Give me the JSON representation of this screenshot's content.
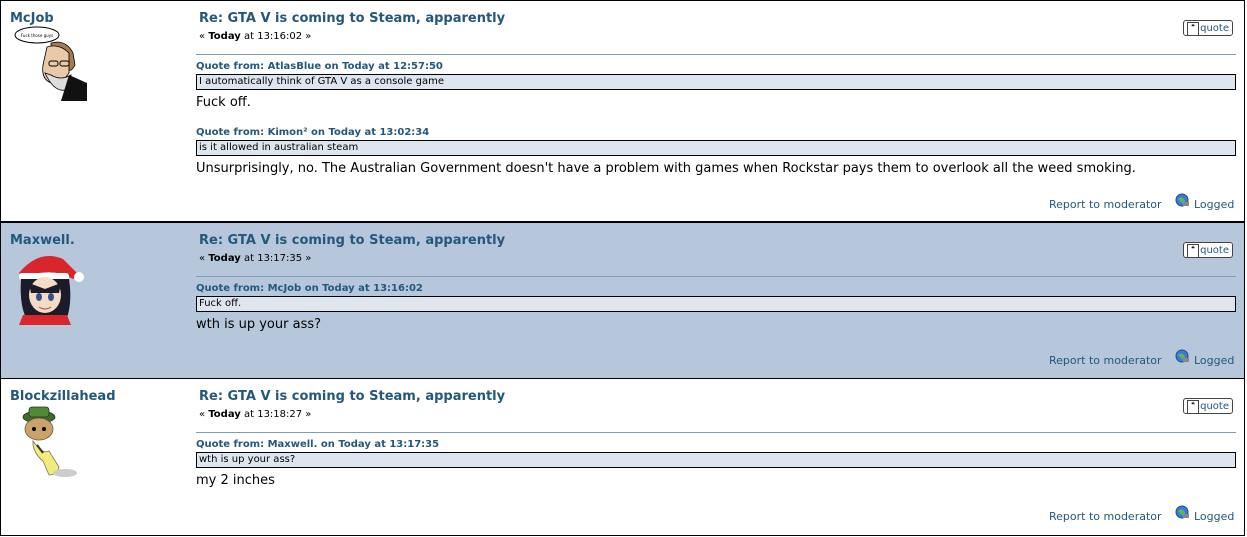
{
  "posts": [
    {
      "author": "McJob",
      "subject": "Re: GTA V is coming to Steam, apparently",
      "date_prefix": "«",
      "date_bold": "Today",
      "date_rest": " at 13:16:02 »",
      "avatar_caption": "Fuck those guys",
      "quote_label": "quote",
      "quotes": [
        {
          "header": "Quote from: AtlasBlue on Today at 12:57:50",
          "text": "I automatically think of GTA V as a console game"
        },
        {
          "header": "Quote from: Kimon² on Today at 13:02:34",
          "text": "is it allowed in australian steam"
        }
      ],
      "replies": [
        "Fuck off.",
        "Unsurprisingly, no. The Australian Government doesn't have a problem with games when Rockstar pays them to overlook all the weed smoking."
      ],
      "report": "Report to moderator",
      "logged": "Logged"
    },
    {
      "author": "Maxwell.",
      "subject": "Re: GTA V is coming to Steam, apparently",
      "date_prefix": "«",
      "date_bold": "Today",
      "date_rest": " at 13:17:35 »",
      "quote_label": "quote",
      "quotes": [
        {
          "header": "Quote from: McJob on Today at 13:16:02",
          "text": "Fuck off."
        }
      ],
      "replies": [
        "wth is up your ass?"
      ],
      "report": "Report to moderator",
      "logged": "Logged"
    },
    {
      "author": "Blockzillahead",
      "subject": "Re: GTA V is coming to Steam, apparently",
      "date_prefix": "«",
      "date_bold": "Today",
      "date_rest": " at 13:18:27 »",
      "quote_label": "quote",
      "quotes": [
        {
          "header": "Quote from: Maxwell. on Today at 13:17:35",
          "text": "wth is up your ass?"
        }
      ],
      "replies": [
        "my 2 inches"
      ],
      "report": "Report to moderator",
      "logged": "Logged"
    }
  ],
  "colors": {
    "alt_row": "#b6c7db",
    "link": "#23587a",
    "quote_bg": "#dde5ef"
  }
}
